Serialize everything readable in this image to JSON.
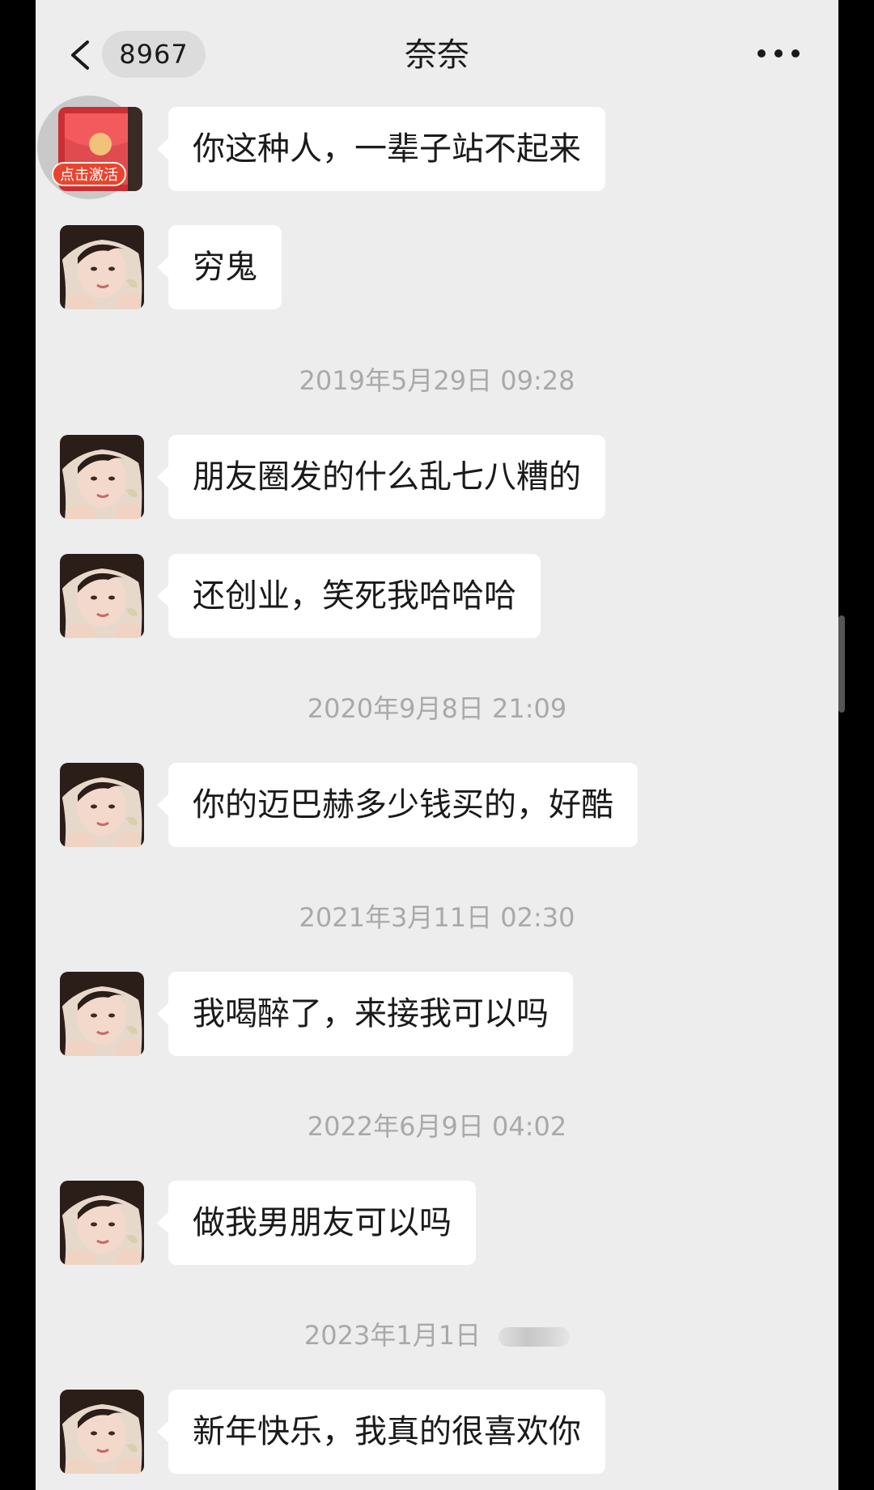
{
  "header": {
    "unread_count": "8967",
    "title": "奈奈"
  },
  "redpacket": {
    "label": "点击激活"
  },
  "messages": [
    {
      "text": "你这种人，一辈子站不起来"
    },
    {
      "text": "穷鬼"
    },
    {
      "timestamp": "2019年5月29日  09:28"
    },
    {
      "text": "朋友圈发的什么乱七八糟的"
    },
    {
      "text": "还创业，笑死我哈哈哈"
    },
    {
      "timestamp": "2020年9月8日  21:09"
    },
    {
      "text": "你的迈巴赫多少钱买的，好酷"
    },
    {
      "timestamp": "2021年3月11日  02:30"
    },
    {
      "text": "我喝醉了，来接我可以吗"
    },
    {
      "timestamp": "2022年6月9日  04:02"
    },
    {
      "text": "做我男朋友可以吗"
    },
    {
      "timestamp": "2023年1月1日"
    },
    {
      "text": "新年快乐，我真的很喜欢你"
    }
  ],
  "colors": {
    "chat_background": "#ededed",
    "bubble": "#ffffff",
    "timestamp_text": "#a9a9a9",
    "redpacket": "#e9442f"
  },
  "icons": [
    "back-chevron-icon",
    "more-icon",
    "red-packet-icon"
  ]
}
